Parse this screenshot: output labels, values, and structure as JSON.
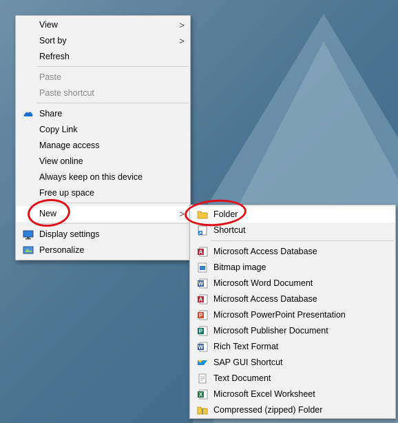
{
  "context_menu": {
    "items": [
      {
        "label": "View"
      },
      {
        "label": "Sort by"
      },
      {
        "label": "Refresh"
      },
      {
        "label": "Paste"
      },
      {
        "label": "Paste shortcut"
      },
      {
        "label": "Share"
      },
      {
        "label": "Copy Link"
      },
      {
        "label": "Manage access"
      },
      {
        "label": "View online"
      },
      {
        "label": "Always keep on this device"
      },
      {
        "label": "Free up space"
      },
      {
        "label": "New"
      },
      {
        "label": "Display settings"
      },
      {
        "label": "Personalize"
      }
    ],
    "chevron": ">"
  },
  "new_submenu": {
    "items": [
      {
        "label": "Folder"
      },
      {
        "label": "Shortcut"
      },
      {
        "label": "Microsoft Access Database"
      },
      {
        "label": "Bitmap image"
      },
      {
        "label": "Microsoft Word Document"
      },
      {
        "label": "Microsoft Access Database"
      },
      {
        "label": "Microsoft PowerPoint Presentation"
      },
      {
        "label": "Microsoft Publisher Document"
      },
      {
        "label": "Rich Text Format"
      },
      {
        "label": "SAP GUI Shortcut"
      },
      {
        "label": "Text Document"
      },
      {
        "label": "Microsoft Excel Worksheet"
      },
      {
        "label": "Compressed (zipped) Folder"
      }
    ]
  },
  "colors": {
    "annotation": "#e0101a",
    "onedrive": "#1a6fd0",
    "folder": "#f3c83f",
    "access": "#b7293b",
    "word": "#2b5797",
    "powerpoint": "#d24726",
    "publisher": "#077568",
    "excel": "#1e7145"
  }
}
